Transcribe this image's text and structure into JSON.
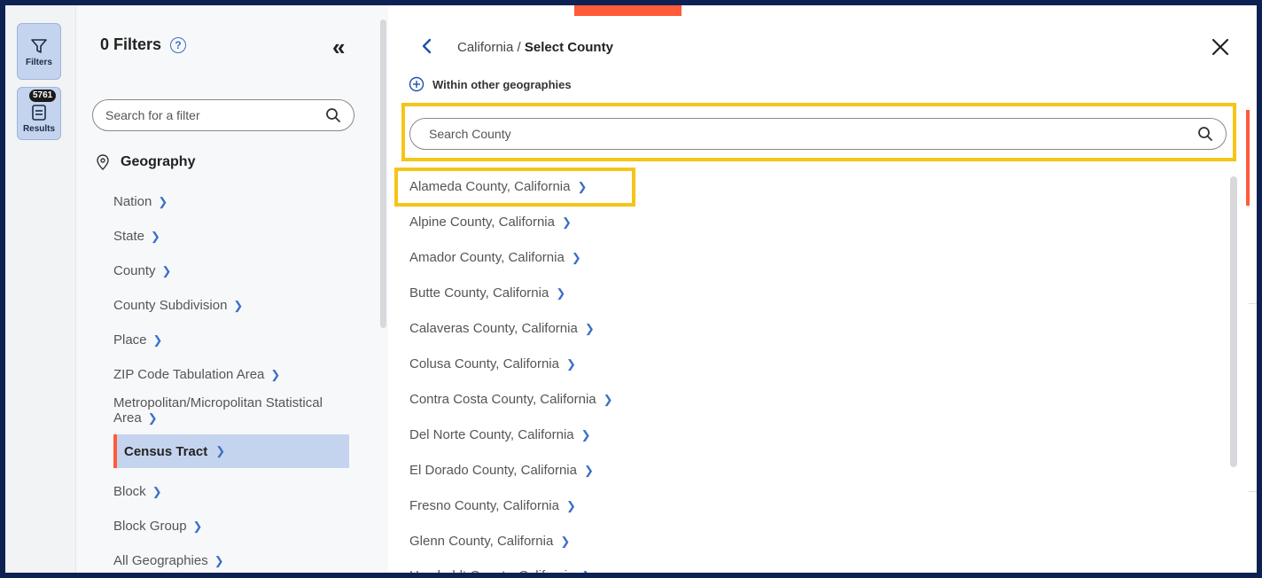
{
  "sidebar_rail": {
    "filters_label": "Filters",
    "results_label": "Results",
    "results_count": "5761"
  },
  "filters_panel": {
    "title": "0 Filters",
    "search_placeholder": "Search for a filter",
    "geography_heading": "Geography",
    "items": [
      {
        "label": "Nation"
      },
      {
        "label": "State"
      },
      {
        "label": "County"
      },
      {
        "label": "County Subdivision"
      },
      {
        "label": "Place"
      },
      {
        "label": "ZIP Code Tabulation Area"
      },
      {
        "label": "Metropolitan/Micropolitan Statistical Area"
      },
      {
        "label": "Census Tract"
      },
      {
        "label": "Block"
      },
      {
        "label": "Block Group"
      },
      {
        "label": "All Geographies"
      }
    ]
  },
  "main": {
    "breadcrumb_parent": "California",
    "breadcrumb_separator": "/",
    "breadcrumb_current": "Select County",
    "within_label": "Within other geographies",
    "search_placeholder": "Search County",
    "counties": [
      "Alameda County, California",
      "Alpine County, California",
      "Amador County, California",
      "Butte County, California",
      "Calaveras County, California",
      "Colusa County, California",
      "Contra Costa County, California",
      "Del Norte County, California",
      "El Dorado County, California",
      "Fresno County, California",
      "Glenn County, California",
      "Humboldt County, California"
    ]
  },
  "colors": {
    "frame": "#0d2153",
    "accent": "#ff5b3a",
    "highlight": "#f5c518",
    "link_blue": "#3b6fc7",
    "active_bg": "#c5d4ee"
  }
}
